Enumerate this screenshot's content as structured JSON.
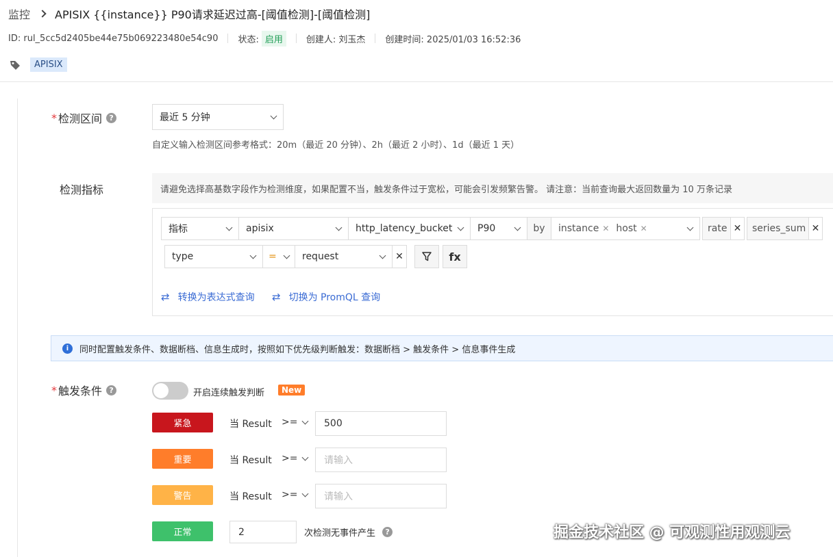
{
  "breadcrumb": {
    "root": "监控",
    "title": "APISIX {{instance}} P90请求延迟过高-[阈值检测]-[阈值检测]"
  },
  "meta": {
    "id": "ID: rul_5cc5d2405be44e75b069223480e54c90",
    "status_label": "状态:",
    "status_value": "启用",
    "creator": "创建人: 刘玉杰",
    "created_time": "创建时间: 2025/01/03 16:52:36"
  },
  "tags": [
    "APISIX"
  ],
  "detection_interval": {
    "label": "检测区间",
    "value": "最近 5 分钟",
    "hint": "自定义输入检测区间参考格式：20m（最近 20 分钟）、2h（最近 2 小时）、1d（最近 1 天）"
  },
  "metric": {
    "label": "检测指标",
    "notice": "请避免选择高基数字段作为检测维度，如果配置不当，触发条件过于宽松，可能会引发频繁告警。 请注意：当前查询最大返回数量为 10 万条记录",
    "row1": {
      "type": "指标",
      "source": "apisix",
      "metric_name": "http_latency_bucket",
      "aggregation": "P90",
      "by_label": "by",
      "group_by": [
        "instance",
        "host"
      ],
      "func1": "rate",
      "func2": "series_sum"
    },
    "row2": {
      "field": "type",
      "operator": "=",
      "value": "request",
      "fx_label": "fx"
    },
    "links": {
      "expression": "转换为表达式查询",
      "promql": "切换为 PromQL 查询"
    }
  },
  "info_bar": {
    "text": "同时配置触发条件、数据断档、信息生成时，按照如下优先级判断触发：数据断档 > 触发条件 > 信息事件生成"
  },
  "trigger": {
    "label": "触发条件",
    "toggle_label": "开启连续触发判断",
    "new_badge": "New",
    "rules": [
      {
        "level": "紧急",
        "color": "#c8161d",
        "when": "当 Result",
        "op": ">=",
        "value": "500",
        "placeholder": "请输入"
      },
      {
        "level": "重要",
        "color": "#ff7d2a",
        "when": "当 Result",
        "op": ">=",
        "value": "",
        "placeholder": "请输入"
      },
      {
        "level": "警告",
        "color": "#ffb347",
        "when": "当 Result",
        "op": ">=",
        "value": "",
        "placeholder": "请输入"
      }
    ],
    "normal": {
      "level": "正常",
      "color": "#3ec16b",
      "count": "2",
      "suffix": "次检测无事件产生"
    }
  },
  "watermark": "掘金技术社区 @ 可观测性用观测云"
}
